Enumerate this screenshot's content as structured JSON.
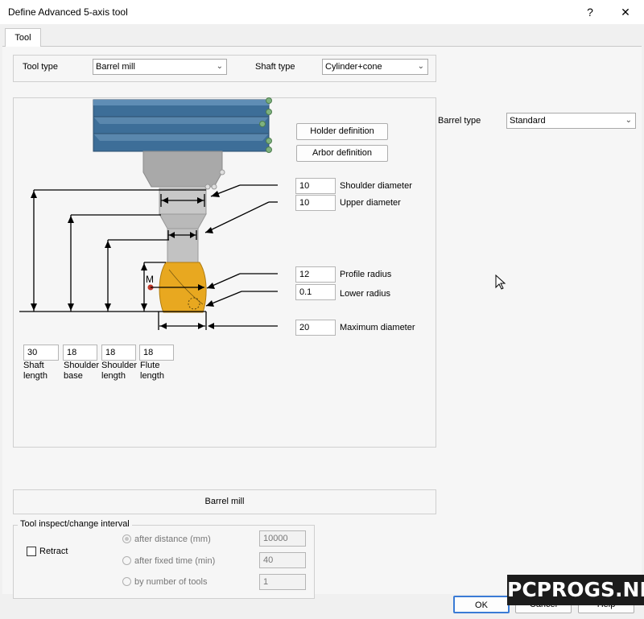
{
  "window": {
    "title": "Define Advanced 5-axis tool",
    "help_glyph": "?",
    "close_glyph": "✕"
  },
  "tabs": [
    {
      "label": "Tool"
    }
  ],
  "tool_type": {
    "label": "Tool type",
    "value": "Barrel mill"
  },
  "shaft_type": {
    "label": "Shaft type",
    "value": "Cylinder+cone"
  },
  "barrel_type": {
    "label": "Barrel type",
    "value": "Standard"
  },
  "buttons": {
    "holder_definition": "Holder definition",
    "arbor_definition": "Arbor definition",
    "ok": "OK",
    "cancel": "Cancel",
    "help": "Help"
  },
  "diagram_params": {
    "shoulder_diameter": {
      "label": "Shoulder diameter",
      "value": "10"
    },
    "upper_diameter": {
      "label": "Upper diameter",
      "value": "10"
    },
    "profile_radius": {
      "label": "Profile radius",
      "value": "12"
    },
    "lower_radius": {
      "label": "Lower radius",
      "value": "0.1"
    },
    "maximum_diameter": {
      "label": "Maximum diameter",
      "value": "20"
    },
    "m_marker": "M"
  },
  "lengths": [
    {
      "value": "30",
      "line1": "Shaft",
      "line2": "length"
    },
    {
      "value": "18",
      "line1": "Shoulder",
      "line2": "base"
    },
    {
      "value": "18",
      "line1": "Shoulder",
      "line2": "length"
    },
    {
      "value": "18",
      "line1": "Flute",
      "line2": "length"
    }
  ],
  "tool_name_bar": "Barrel mill",
  "interval": {
    "title": "Tool inspect/change interval",
    "retract_label": "Retract",
    "after_distance": {
      "label": "after distance (mm)",
      "value": "10000"
    },
    "after_time": {
      "label": "after fixed time (min)",
      "value": "40"
    },
    "by_number": {
      "label": "by number of tools",
      "value": "1"
    }
  },
  "watermark": "PCPROGS.NET",
  "colors": {
    "holder": "#3d6e98",
    "tool_body": "#b8b8b8",
    "flute": "#e8a820",
    "marker": "#c0392b",
    "handle": "#7fb27f"
  },
  "icons": {
    "dropdown": "chevron-down-icon",
    "cursor": "mouse-cursor-icon"
  }
}
